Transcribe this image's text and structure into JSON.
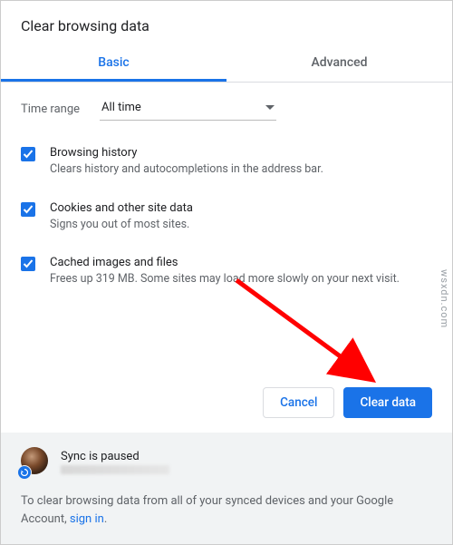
{
  "dialog": {
    "title": "Clear browsing data"
  },
  "tabs": {
    "basic": "Basic",
    "advanced": "Advanced"
  },
  "time": {
    "label": "Time range",
    "selected": "All time"
  },
  "options": [
    {
      "title": "Browsing history",
      "desc": "Clears history and autocompletions in the address bar."
    },
    {
      "title": "Cookies and other site data",
      "desc": "Signs you out of most sites."
    },
    {
      "title": "Cached images and files",
      "desc": "Frees up 319 MB. Some sites may load more slowly on your next visit."
    }
  ],
  "actions": {
    "cancel": "Cancel",
    "clear": "Clear data"
  },
  "sync": {
    "status": "Sync is paused"
  },
  "footer": {
    "note": "To clear browsing data from all of your synced devices and your Google Account, ",
    "signin": "sign in",
    "period": "."
  },
  "watermark": "wsxdn.com"
}
